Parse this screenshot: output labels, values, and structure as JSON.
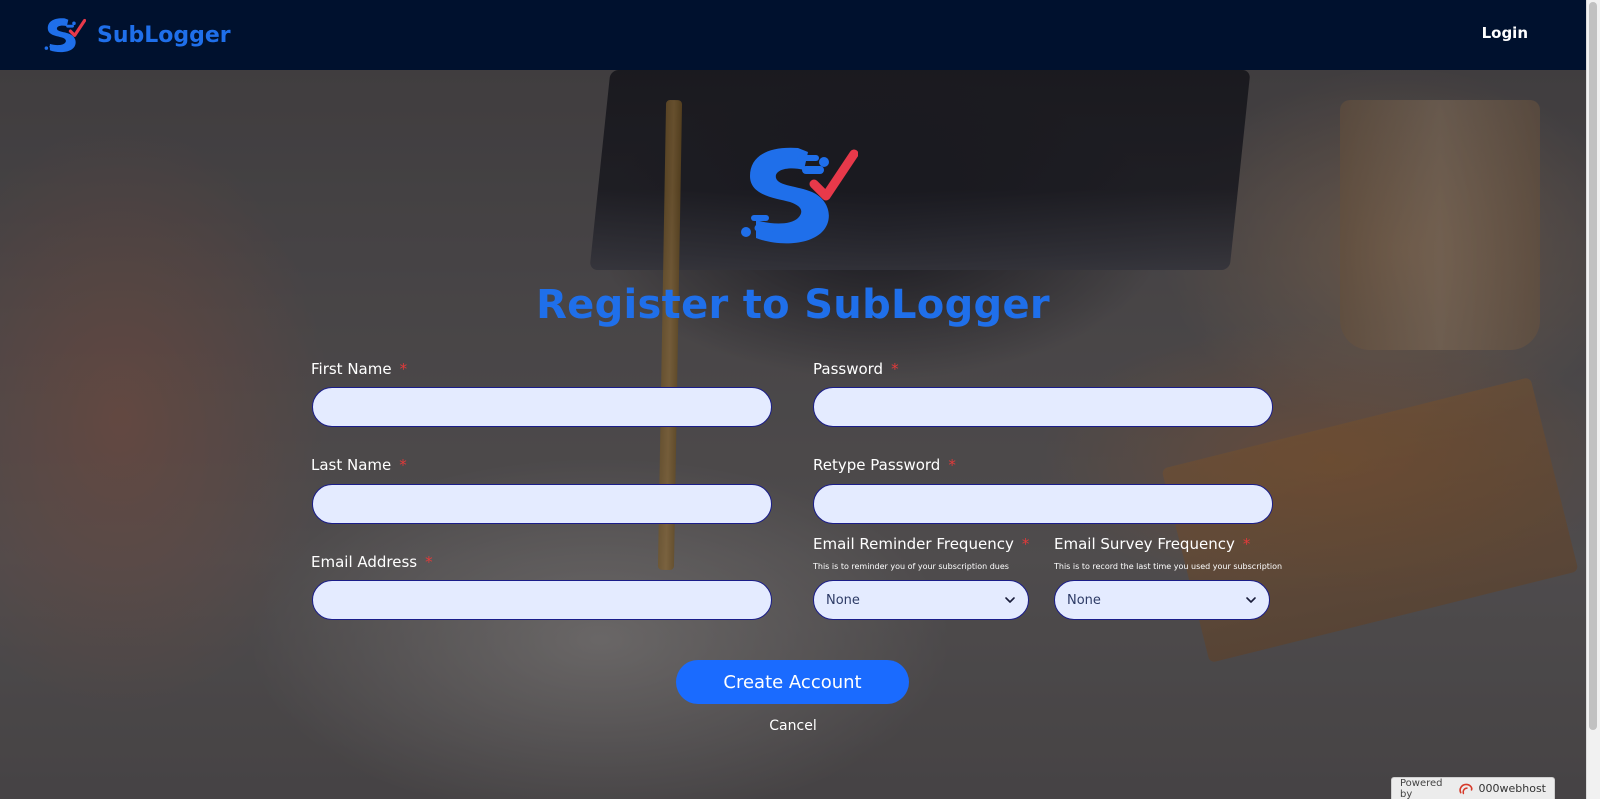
{
  "header": {
    "brand_name": "SubLogger",
    "login_label": "Login"
  },
  "main": {
    "title": "Register to SubLogger",
    "fields": {
      "first_name": {
        "label": "First Name",
        "required": "*",
        "value": ""
      },
      "last_name": {
        "label": "Last Name",
        "required": "*",
        "value": ""
      },
      "email": {
        "label": "Email Address",
        "required": "*",
        "value": ""
      },
      "password": {
        "label": "Password",
        "required": "*",
        "value": ""
      },
      "retype_password": {
        "label": "Retype Password",
        "required": "*",
        "value": ""
      },
      "reminder_frequency": {
        "label": "Email Reminder Frequency",
        "required": "*",
        "hint": "This is to reminder you of your subscription dues",
        "selected": "None"
      },
      "survey_frequency": {
        "label": "Email Survey Frequency",
        "required": "*",
        "hint": "This is to record the last time you used your subscription",
        "selected": "None"
      }
    },
    "create_button": "Create Account",
    "cancel_label": "Cancel"
  },
  "footer": {
    "powered_by": "Powered by",
    "host_name": "000webhost"
  },
  "colors": {
    "header_bg": "#00112e",
    "accent_blue": "#1f6fea",
    "button_blue": "#1a6bff",
    "input_bg": "#e4ebff",
    "input_border": "#1a1d8a",
    "required_red": "#e23a3a",
    "check_red": "#e8394a"
  },
  "icons": {
    "brand": "sublogger-logo-icon",
    "dropdown": "chevron-down-icon",
    "host": "000webhost-logo-icon"
  }
}
